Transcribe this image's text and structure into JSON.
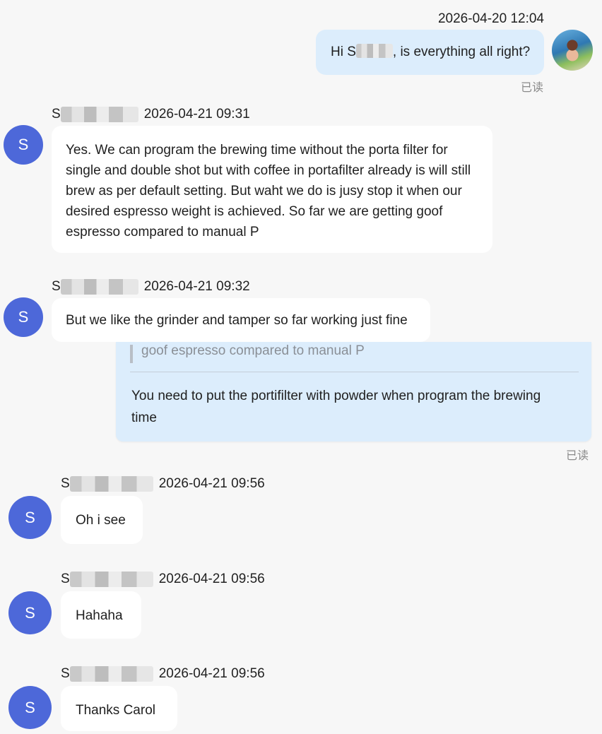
{
  "messages": [
    {
      "sender": "me",
      "timestamp": "2026-04-20 12:04",
      "text_prefix": "Hi S",
      "text_suffix": ", is everything all right?",
      "status": "已读"
    },
    {
      "sender": "S",
      "sender_initial": "S",
      "name_initial": "S",
      "timestamp": "2026-04-21 09:31",
      "text": "Yes. We can program the brewing time without the porta filter for single and double shot but with coffee in portafilter already is will still brew as per default setting. But waht we do is jusy stop it when our desired espresso weight is achieved. So far we are getting goof espresso compared to manual P"
    },
    {
      "sender": "S",
      "sender_initial": "S",
      "name_initial": "S",
      "timestamp": "2026-04-21 09:32",
      "text": "But we like the grinder and tamper so far working just fine"
    },
    {
      "sender": "me",
      "quote": "goof espresso compared to manual P",
      "text": "You need to put the portifilter with powder when program the brewing time",
      "status": "已读"
    },
    {
      "sender": "S",
      "sender_initial": "S",
      "name_initial": "S",
      "timestamp": "2026-04-21 09:56",
      "text": "Oh i see"
    },
    {
      "sender": "S",
      "sender_initial": "S",
      "name_initial": "S",
      "timestamp": "2026-04-21 09:56",
      "text": "Hahaha"
    },
    {
      "sender": "S",
      "sender_initial": "S",
      "name_initial": "S",
      "timestamp": "2026-04-21 09:56",
      "text": "Thanks Carol"
    }
  ],
  "colors": {
    "avatar": "#4d68d9",
    "my_bubble": "#dcedfc",
    "their_bubble": "#ffffff",
    "background": "#f7f7f7"
  }
}
